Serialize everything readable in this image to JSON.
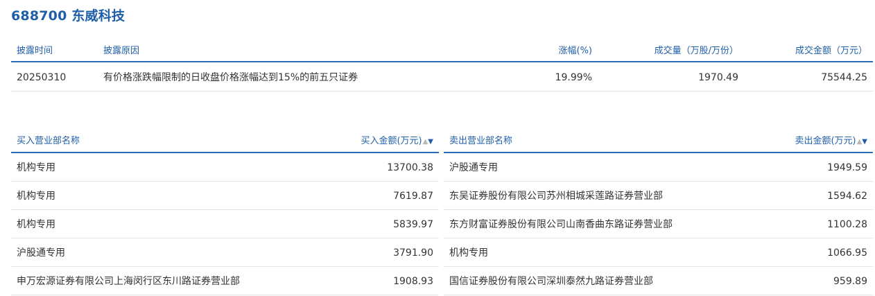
{
  "header": {
    "code": "688700",
    "name": "东威科技"
  },
  "summary": {
    "columns": {
      "date": "披露时间",
      "reason": "披露原因",
      "change": "涨幅(%)",
      "volume": "成交量（万股/万份）",
      "amount": "成交金额（万元）"
    },
    "row": {
      "date": "20250310",
      "reason": "有价格涨跌幅限制的日收盘价格涨幅达到15%的前五只证券",
      "change": "19.99%",
      "volume": "1970.49",
      "amount": "75544.25"
    }
  },
  "buy": {
    "columns": {
      "name": "买入营业部名称",
      "amount": "买入金额(万元)"
    },
    "sort_icons": {
      "up": "▲",
      "down": "▼"
    },
    "rows": [
      {
        "name": "机构专用",
        "amount": "13700.38"
      },
      {
        "name": "机构专用",
        "amount": "7619.87"
      },
      {
        "name": "机构专用",
        "amount": "5839.97"
      },
      {
        "name": "沪股通专用",
        "amount": "3791.90"
      },
      {
        "name": "申万宏源证券有限公司上海闵行区东川路证券营业部",
        "amount": "1908.93"
      }
    ]
  },
  "sell": {
    "columns": {
      "name": "卖出营业部名称",
      "amount": "卖出金额(万元)"
    },
    "sort_icons": {
      "up": "▲",
      "down": "▼"
    },
    "rows": [
      {
        "name": "沪股通专用",
        "amount": "1949.59"
      },
      {
        "name": "东吴证券股份有限公司苏州相城采莲路证券营业部",
        "amount": "1594.62"
      },
      {
        "name": "东方财富证券股份有限公司山南香曲东路证券营业部",
        "amount": "1100.28"
      },
      {
        "name": "机构专用",
        "amount": "1066.95"
      },
      {
        "name": "国信证券股份有限公司深圳泰然九路证券营业部",
        "amount": "959.89"
      }
    ]
  },
  "colors": {
    "accent": "#1f5fa8",
    "rule": "#2a6ab8",
    "text": "#333333",
    "divider": "#e4e4e4"
  }
}
